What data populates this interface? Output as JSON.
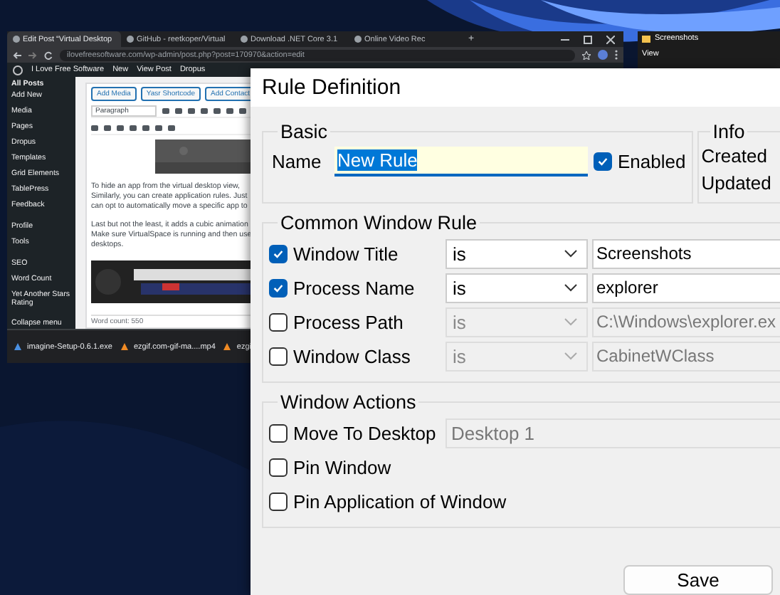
{
  "browser": {
    "tabs": [
      {
        "title": "Edit Post “Virtual Desktop",
        "selected": true
      },
      {
        "title": "GitHub - reetkoper/Virtual",
        "selected": false
      },
      {
        "title": "Download .NET Core 3.1",
        "selected": false
      },
      {
        "title": "Online Video Rec",
        "selected": false
      }
    ],
    "new_tab": "+",
    "url": "ilovefreesoftware.com/wp-admin/post.php?post=170970&action=edit",
    "admin_bar": [
      "I Love Free Software",
      "New",
      "View Post",
      "Dropus"
    ],
    "sidebar": {
      "heading": "All Posts",
      "groups": [
        [
          "Add New",
          "Media",
          "Pages",
          "Dropus",
          "Templates",
          "Grid Elements",
          "TablePress",
          "Feedback"
        ],
        [
          "Profile",
          "Tools"
        ],
        [
          "SEO",
          "Word Count",
          "Yet Another Stars Rating"
        ],
        [
          "Collapse menu"
        ]
      ]
    },
    "editor": {
      "buttons": [
        "Add Media",
        "Yasr Shortcode",
        "Add Contact"
      ],
      "format": "Paragraph",
      "paragraphs": [
        [
          "To hide an app from the virtual desktop view,",
          "Similarly, you can create application rules. Just",
          "can opt to automatically move a specific app to"
        ],
        [
          "Last but not the least, it adds a cubic animation",
          "Make sure VirtualSpace is running and then use",
          "desktops."
        ]
      ],
      "word_count": "Word count: 550"
    },
    "downloads": [
      "imagine-Setup-0.6.1.exe",
      "ezgif.com-gif-ma....mp4",
      "ezgi"
    ]
  },
  "explorer": {
    "title": "Screenshots",
    "view": "View"
  },
  "dialog": {
    "title": "Rule Definition",
    "basic": {
      "title": "Basic",
      "name_label": "Name",
      "name_value": "New Rule",
      "enabled_label": "Enabled",
      "enabled": true
    },
    "info": {
      "title": "Info",
      "labels": [
        "Created",
        "Updated"
      ]
    },
    "common": {
      "title": "Common Window Rule",
      "rows": [
        {
          "label": "Window Title",
          "checked": true,
          "operator": "is",
          "value": "Screenshots"
        },
        {
          "label": "Process Name",
          "checked": true,
          "operator": "is",
          "value": "explorer"
        },
        {
          "label": "Process Path",
          "checked": false,
          "operator": "is",
          "value": "C:\\Windows\\explorer.ex"
        },
        {
          "label": "Window Class",
          "checked": false,
          "operator": "is",
          "value": "CabinetWClass"
        }
      ]
    },
    "actions": {
      "title": "Window Actions",
      "items": [
        {
          "label": "Move To Desktop",
          "checked": false,
          "kind": "select",
          "value": "Desktop 1"
        },
        {
          "label": "Pin Window",
          "checked": false,
          "kind": "plain"
        },
        {
          "label": "Pin Application of Window",
          "checked": false,
          "kind": "plain"
        }
      ]
    },
    "save": "Save"
  }
}
